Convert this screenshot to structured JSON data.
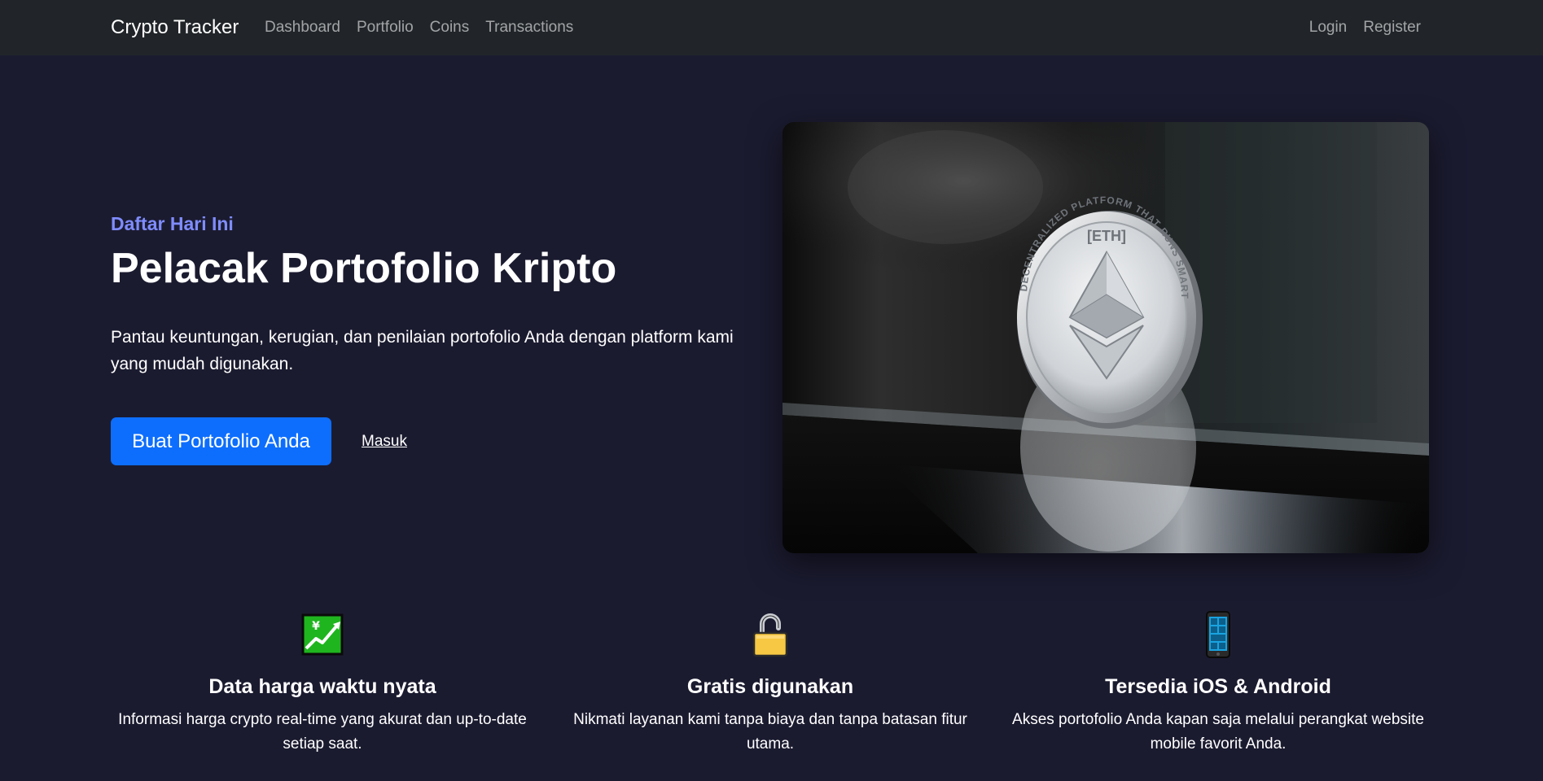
{
  "navbar": {
    "brand": "Crypto Tracker",
    "links": [
      {
        "label": "Dashboard"
      },
      {
        "label": "Portfolio"
      },
      {
        "label": "Coins"
      },
      {
        "label": "Transactions"
      }
    ],
    "auth": [
      {
        "label": "Login"
      },
      {
        "label": "Register"
      }
    ]
  },
  "hero": {
    "eyebrow": "Daftar Hari Ini",
    "title": "Pelacak Portofolio Kripto",
    "lead": "Pantau keuntungan, kerugian, dan penilaian portofolio Anda dengan platform kami yang mudah digunakan.",
    "primary_button": "Buat Portofolio Anda",
    "secondary_link": "Masuk",
    "image": {
      "icon": "ethereum-coin-photo",
      "coin_label": "[ETH]",
      "coin_ring_text": "DECENTRALIZED PLATFORM THAT RUNS SMART CONTRACTS"
    }
  },
  "features": [
    {
      "icon": "chart-increasing-with-yen-icon",
      "title": "Data harga waktu nyata",
      "text": "Informasi harga crypto real-time yang akurat dan up-to-date setiap saat."
    },
    {
      "icon": "open-padlock-icon",
      "title": "Gratis digunakan",
      "text": "Nikmati layanan kami tanpa biaya dan tanpa batasan fitur utama."
    },
    {
      "icon": "mobile-phone-icon",
      "title": "Tersedia iOS & Android",
      "text": "Akses portofolio Anda kapan saja melalui perangkat website mobile favorit Anda."
    }
  ],
  "colors": {
    "background": "#1b1b30",
    "navbar": "#212529",
    "accent": "#7f8cff",
    "primary": "#0d6efd"
  }
}
